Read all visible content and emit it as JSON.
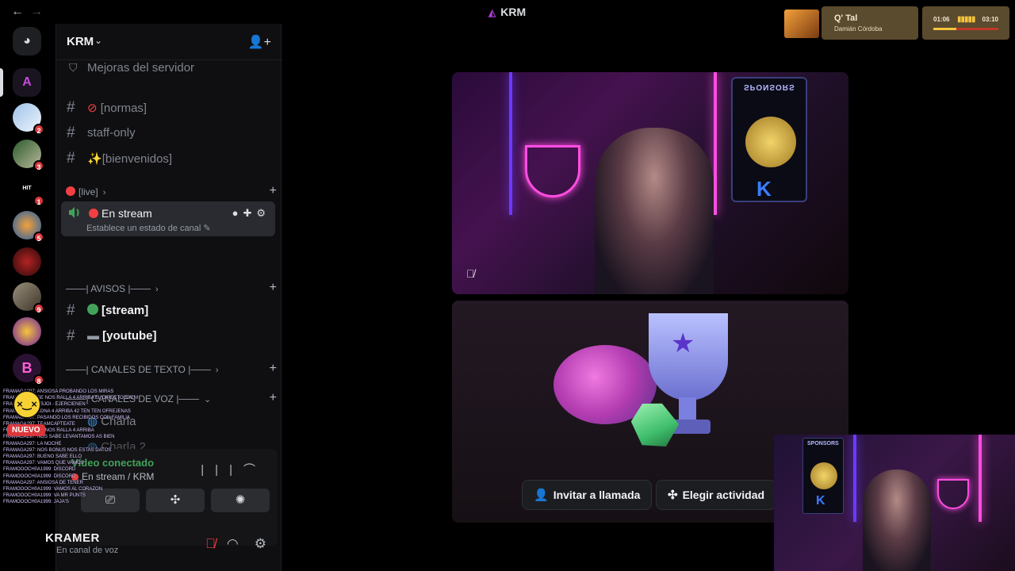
{
  "window": {
    "title": "KRM"
  },
  "server_rail": {
    "badges": [
      "2",
      "3",
      "1",
      "5",
      "9",
      "8"
    ]
  },
  "server": {
    "name": "KRM",
    "boost_item": "Mejoras del servidor",
    "channels_top": [
      "[normas]",
      "staff-only",
      "[bienvenidos]"
    ],
    "live_category": "[live]",
    "active_voice": {
      "name": "En stream",
      "status": "Establece un estado de canal"
    },
    "avisos_category": "───| AVISOS |───",
    "avisos_channels": [
      "[stream]",
      "[youtube]"
    ],
    "text_category": "───| CANALES DE TEXTO |───",
    "voice_category": "───| CANALES DE VOZ |───",
    "voice_channels": [
      "Charla",
      "Charla 2"
    ]
  },
  "voice_panel": {
    "status": "Vídeo conectado",
    "channel": "En stream / KRM"
  },
  "user": {
    "name": "KRAMER",
    "status": "En canal de voz"
  },
  "chat_overlay": {
    "new_badge": "NUEVO",
    "lines": [
      "FRAMAGA297: ANSIOSA PROBANDO LOS MIRAS",
      "FRAMAGA297: SE NOS RALLA 4 ARRIBA EL DIRECTO SIN MIRAS",
      "FRAMAGA297: EBJOI - EJERCIENEN",
      "FRAMAGA297: ZONA 4 ARRIBA 42 TEN TEN OFREJENAS",
      "FRAMAGA297: PASANDO LOS RECIBIDOS CON FAMILIA",
      "FRAMAGA297: TEAMCAPTEATE",
      "FRAMAGA297: SE NOS RALLA 4 ARRIBA",
      "FRAMAGA297: NOS SABE LEVANTAMOS AS BIEN",
      "FRAMAGA297: LA NOCHE",
      "FRAMAGA297: NOS BONUS NOS ESTAS DATOS",
      "FRAMAGA297: BUENO SABE ELLO",
      "FRAMAGA297: VAMOS QUE VAMOS",
      "FRAMOOOCH0A1999: DISCORD",
      "FRAMOOOCH0A1999: DISCORD",
      "FRAMAGA297: ANSIOSA DE TENER",
      "FRAMOOOCH0A1999: VAMOS AL CORAZON",
      "FRAMOOOCH0A1999: VA MR PUNTS",
      "FRAMOOOCH0A1999: JAJA'S"
    ]
  },
  "stage": {
    "sponsor_label": "SPONSORS",
    "actions": [
      "Invitar a llamada",
      "Elegir actividad"
    ]
  },
  "now_playing": {
    "title": "Q' Tal",
    "artist": "Damián Córdoba",
    "elapsed": "01:06",
    "total": "03:10",
    "progress": 0.35
  },
  "colors": {
    "accent_live": "#f23f42",
    "online": "#43a25a",
    "neon_violet": "#6a3bff",
    "neon_pink": "#ff4de1",
    "overlay_gold": "#5a4a2e"
  }
}
